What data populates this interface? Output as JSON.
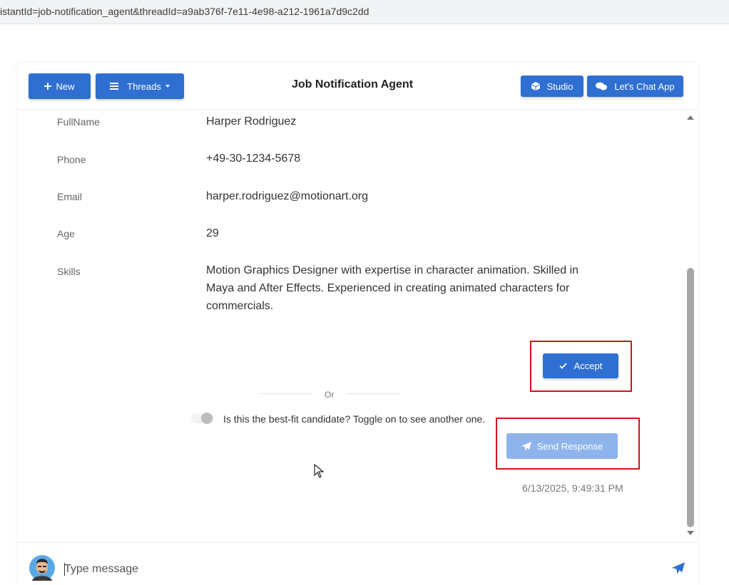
{
  "browser": {
    "url": "istantId=job-notification_agent&threadId=a9ab376f-7e11-4e98-a212-1961a7d9c2dd"
  },
  "header": {
    "new_label": "New",
    "threads_label": "Threads",
    "title": "Job Notification Agent",
    "studio_label": "Studio",
    "chat_app_label": "Let's Chat App"
  },
  "candidate": {
    "fields": [
      {
        "label": "FullName",
        "value": "Harper Rodriguez"
      },
      {
        "label": "Phone",
        "value": "+49-30-1234-5678"
      },
      {
        "label": "Email",
        "value": "harper.rodriguez@motionart.org"
      },
      {
        "label": "Age",
        "value": "29"
      },
      {
        "label": "Skills",
        "value": "Motion Graphics Designer with expertise in character animation. Skilled in Maya and After Effects. Experienced in creating animated characters for commercials."
      }
    ]
  },
  "actions": {
    "accept_label": "Accept",
    "or_label": "Or",
    "toggle_text": "Is this the best-fit candidate? Toggle on to see another one.",
    "send_response_label": "Send Response",
    "timestamp": "6/13/2025, 9:49:31 PM"
  },
  "composer": {
    "placeholder": "Type message"
  },
  "colors": {
    "primary": "#2f6fd2",
    "primary_disabled": "#8fb4ec",
    "highlight": "#d0141c"
  }
}
